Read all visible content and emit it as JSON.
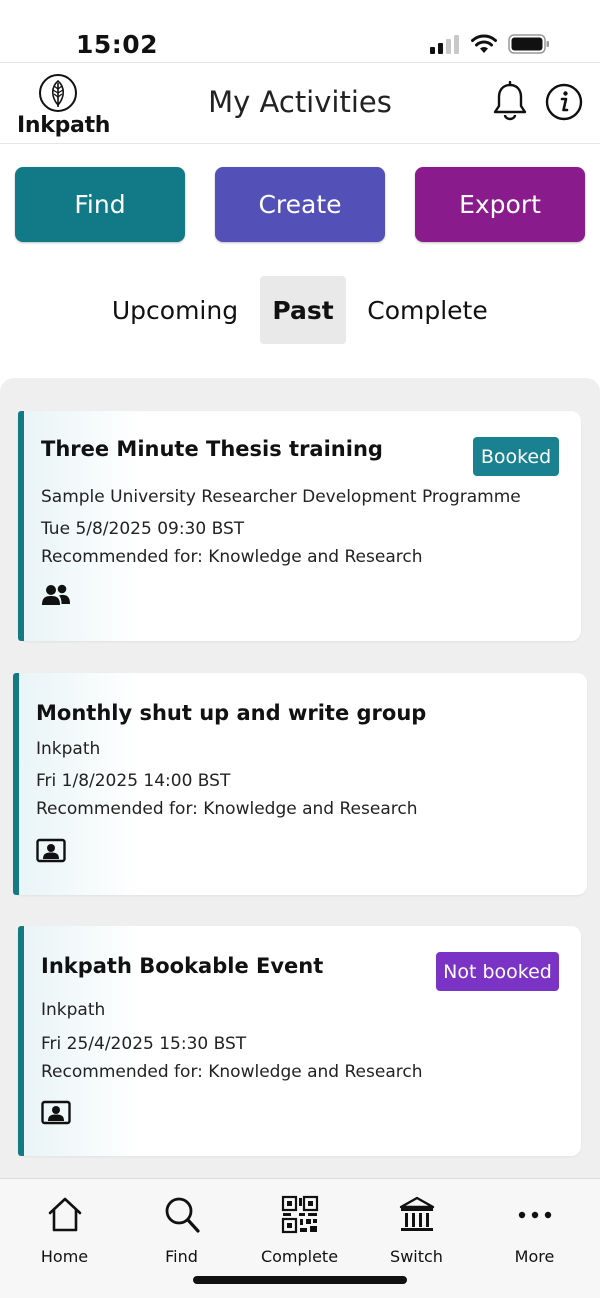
{
  "status_bar": {
    "time": "15:02"
  },
  "header": {
    "logo_text": "Inkpath",
    "title": "My Activities"
  },
  "actions": {
    "find": "Find",
    "create": "Create",
    "export": "Export"
  },
  "tabs": [
    {
      "label": "Upcoming",
      "selected": false
    },
    {
      "label": "Past",
      "selected": true
    },
    {
      "label": "Complete",
      "selected": false
    }
  ],
  "activities": [
    {
      "title": "Three Minute Thesis training",
      "badge": "Booked",
      "provider": "Sample University Researcher Development Programme",
      "datetime": "Tue 5/8/2025 09:30 BST",
      "recommended": "Recommended for: Knowledge and Research",
      "type_icon": "group-icon"
    },
    {
      "title": "Monthly shut up and write group",
      "badge": "",
      "provider": "Inkpath",
      "datetime": "Fri 1/8/2025 14:00 BST",
      "recommended": "Recommended for: Knowledge and Research",
      "type_icon": "online-session-icon"
    },
    {
      "title": "Inkpath Bookable Event",
      "badge": "Not booked",
      "provider": "Inkpath",
      "datetime": "Fri 25/4/2025 15:30 BST",
      "recommended": "Recommended for: Knowledge and Research",
      "type_icon": "online-session-icon"
    }
  ],
  "bottom_nav": [
    {
      "label": "Home",
      "icon": "home-icon"
    },
    {
      "label": "Find",
      "icon": "search-icon"
    },
    {
      "label": "Complete",
      "icon": "qr-code-icon"
    },
    {
      "label": "Switch",
      "icon": "institution-icon"
    },
    {
      "label": "More",
      "icon": "more-icon"
    }
  ],
  "colors": {
    "find": "#117a86",
    "create": "#5350b8",
    "export": "#8a1b8c",
    "booked": "#1a8190",
    "not_booked": "#7a33c4",
    "accent_bar": "#137a84"
  }
}
